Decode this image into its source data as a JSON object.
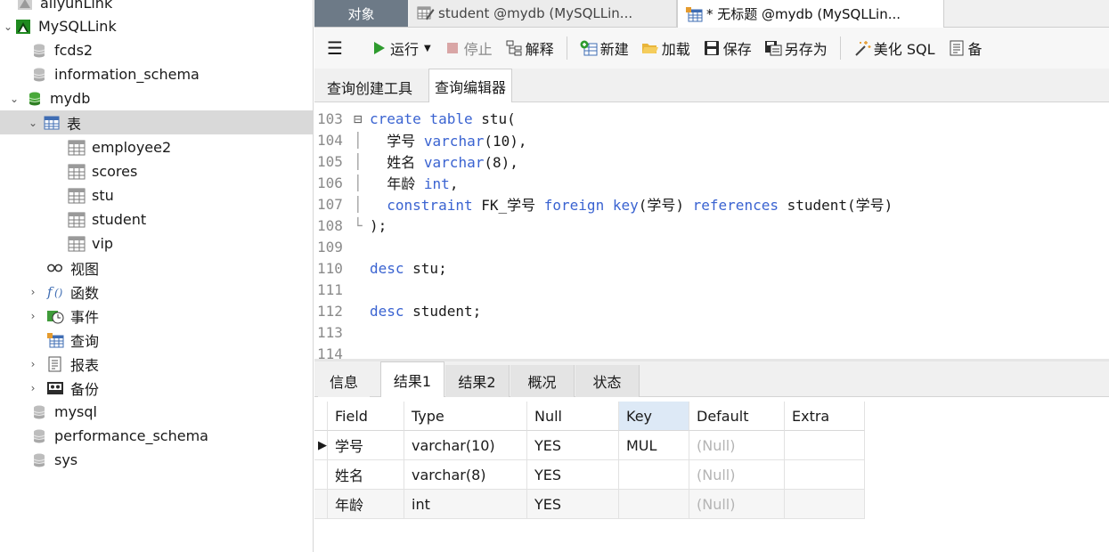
{
  "sidebar": {
    "connection_prev": "aliyunLink",
    "connection": "MySQLLink",
    "databases_top": [
      "fcds2",
      "information_schema"
    ],
    "active_db": "mydb",
    "tables_folder": "表",
    "tables": [
      "employee2",
      "scores",
      "stu",
      "student",
      "vip"
    ],
    "folders": [
      {
        "label": "视图",
        "icon": "view-icon"
      },
      {
        "label": "函数",
        "icon": "function-icon"
      },
      {
        "label": "事件",
        "icon": "event-icon"
      },
      {
        "label": "查询",
        "icon": "query-icon"
      },
      {
        "label": "报表",
        "icon": "report-icon"
      },
      {
        "label": "备份",
        "icon": "backup-icon"
      }
    ],
    "databases_bottom": [
      "mysql",
      "performance_schema",
      "sys"
    ]
  },
  "tabs": {
    "objects": "对象",
    "doc1": "student @mydb (MySQLLin...",
    "doc2": "* 无标题 @mydb (MySQLLin..."
  },
  "toolbar": {
    "run": "运行",
    "stop": "停止",
    "explain": "解释",
    "new": "新建",
    "load": "加载",
    "save": "保存",
    "save_as": "另存为",
    "beautify": "美化 SQL",
    "more": "备"
  },
  "subtabs": {
    "builder": "查询创建工具",
    "editor": "查询编辑器"
  },
  "code": {
    "line_numbers": [
      "103",
      "104",
      "105",
      "106",
      "107",
      "108",
      "109",
      "110",
      "111",
      "112",
      "113",
      "114"
    ],
    "l103_kw": "create table",
    "l103_rest": " stu(",
    "l104_name": "  学号 ",
    "l104_type": "varchar",
    "l104_rest": "(10),",
    "l105_name": "  姓名 ",
    "l105_type": "varchar",
    "l105_rest": "(8),",
    "l106_name": "  年龄 ",
    "l106_type": "int",
    "l106_rest": ",",
    "l107_kw1": "  constraint",
    "l107_mid": " FK_学号 ",
    "l107_kw2": "foreign key",
    "l107_mid2": "(学号) ",
    "l107_kw3": "references",
    "l107_rest": " student(学号)",
    "l108": ");",
    "l110_kw": "desc",
    "l110_rest": " stu;",
    "l112_kw": "desc",
    "l112_rest": " student;"
  },
  "result_tabs": [
    "信息",
    "结果1",
    "结果2",
    "概况",
    "状态"
  ],
  "result": {
    "columns": [
      "Field",
      "Type",
      "Null",
      "Key",
      "Default",
      "Extra"
    ],
    "rows": [
      [
        "学号",
        "varchar(10)",
        "YES",
        "MUL",
        "(Null)",
        ""
      ],
      [
        "姓名",
        "varchar(8)",
        "YES",
        "",
        "(Null)",
        ""
      ],
      [
        "年龄",
        "int",
        "YES",
        "",
        "(Null)",
        ""
      ]
    ],
    "current_row_marker": "▶"
  },
  "colors": {
    "keyword": "#3a63d1",
    "objects_tab": "#6d7a87",
    "selection": "#d9d9d9",
    "run_green": "#2e9b2e",
    "sorted_header": "#dde9f6"
  }
}
